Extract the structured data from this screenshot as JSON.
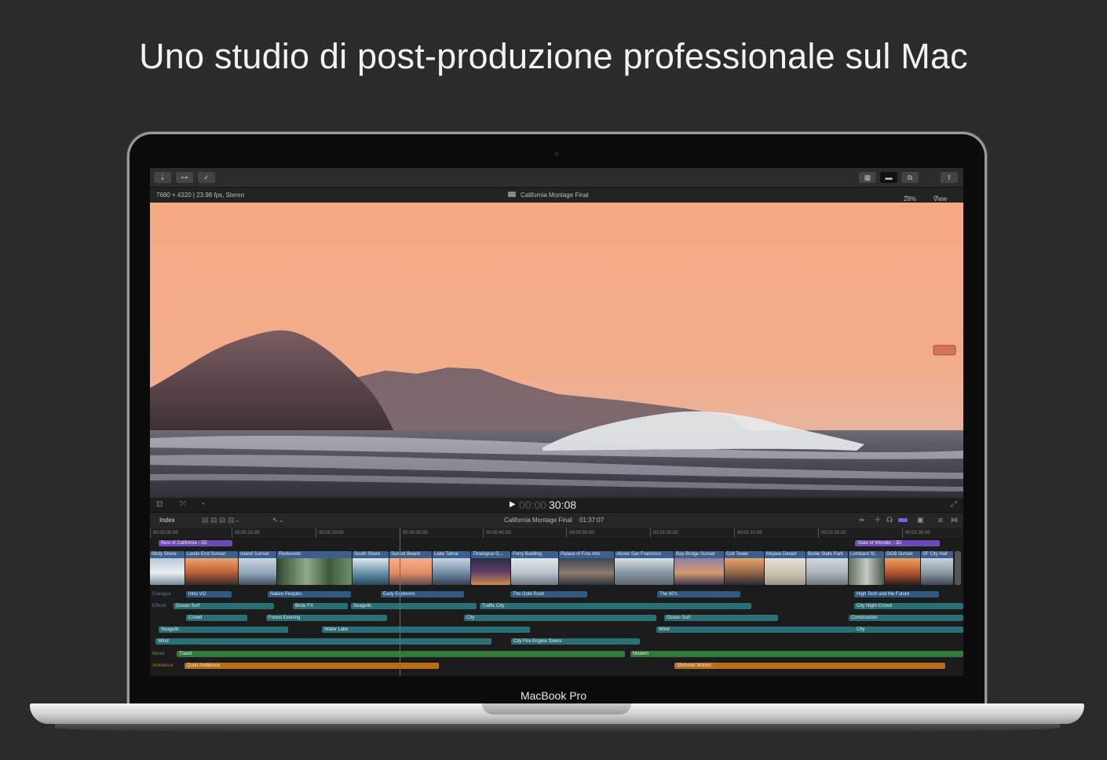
{
  "headline": "Uno studio di post-produzione professionale sul Mac",
  "device_label": "MacBook Pro",
  "app": {
    "format_info": "7680 × 4320 | 23.98 fps, Stereo",
    "project_title": "California Montage Final",
    "zoom": "28%",
    "view_menu": "View",
    "timecode_dim": "00:00",
    "timecode": "30:08",
    "index_button": "Index",
    "timeline_project": "California Montage Final",
    "timeline_duration": "01:37:07",
    "ruler_ticks": [
      "00:00:00:00",
      "00:00:10:00",
      "00:00:20:00",
      "00:00:30:00",
      "00:00:40:00",
      "00:00:50:00",
      "00:01:00:00",
      "00:01:10:00",
      "00:01:20:00",
      "00:01:30:00"
    ],
    "titles": [
      "Best of California - 3D",
      "State of Wonder - 3D"
    ],
    "clips": [
      "Misty Shore",
      "Lands End Sunset",
      "Island Sunset",
      "Redwoods",
      "South Shore",
      "Sunset Beach",
      "Lake Tahoe",
      "Timelapse G...",
      "Ferry Building",
      "Palace of Fine Arts",
      "Above San Francisco",
      "Bay Bridge Sunset",
      "Coit Tower",
      "Mojave Desert",
      "Bodie State Park",
      "Lombard St.",
      "GGB Sunset",
      "SF City Hall"
    ],
    "roles": {
      "dialogue": "Dialogue",
      "effects": "Effects",
      "music": "Music",
      "ambience": "Ambience"
    },
    "dialogue": [
      "Intro VO",
      "Native Peoples",
      "Early Explorers",
      "The Gold Rush",
      "The 60's",
      "High Tech and the Future"
    ],
    "effects_row1": [
      "Ocean Surf",
      "Birds FX",
      "Seagulls",
      "Traffic City",
      "City Night Crowd"
    ],
    "effects_row2": [
      "Crowd",
      "Forest Evening",
      "City",
      "Ocean Surf",
      "Construction"
    ],
    "effects_row3": [
      "Seagulls",
      "Water Lake",
      "Wind",
      "City"
    ],
    "effects_row4": [
      "Wind",
      "City Fire Engine Sirens"
    ],
    "music": [
      "Travel",
      "Modern"
    ],
    "ambience": [
      "Quiet Ambience",
      "Shimmer Motion"
    ]
  },
  "colors": {
    "background": "#2b2b2b",
    "title_bar": "#6c4bb5",
    "clip_header": "#3d5f8e",
    "effects_bar": "#2a6f74",
    "music_bar": "#2f7a3c",
    "ambience_bar": "#b86e1c",
    "playhead": "#d9432b"
  }
}
